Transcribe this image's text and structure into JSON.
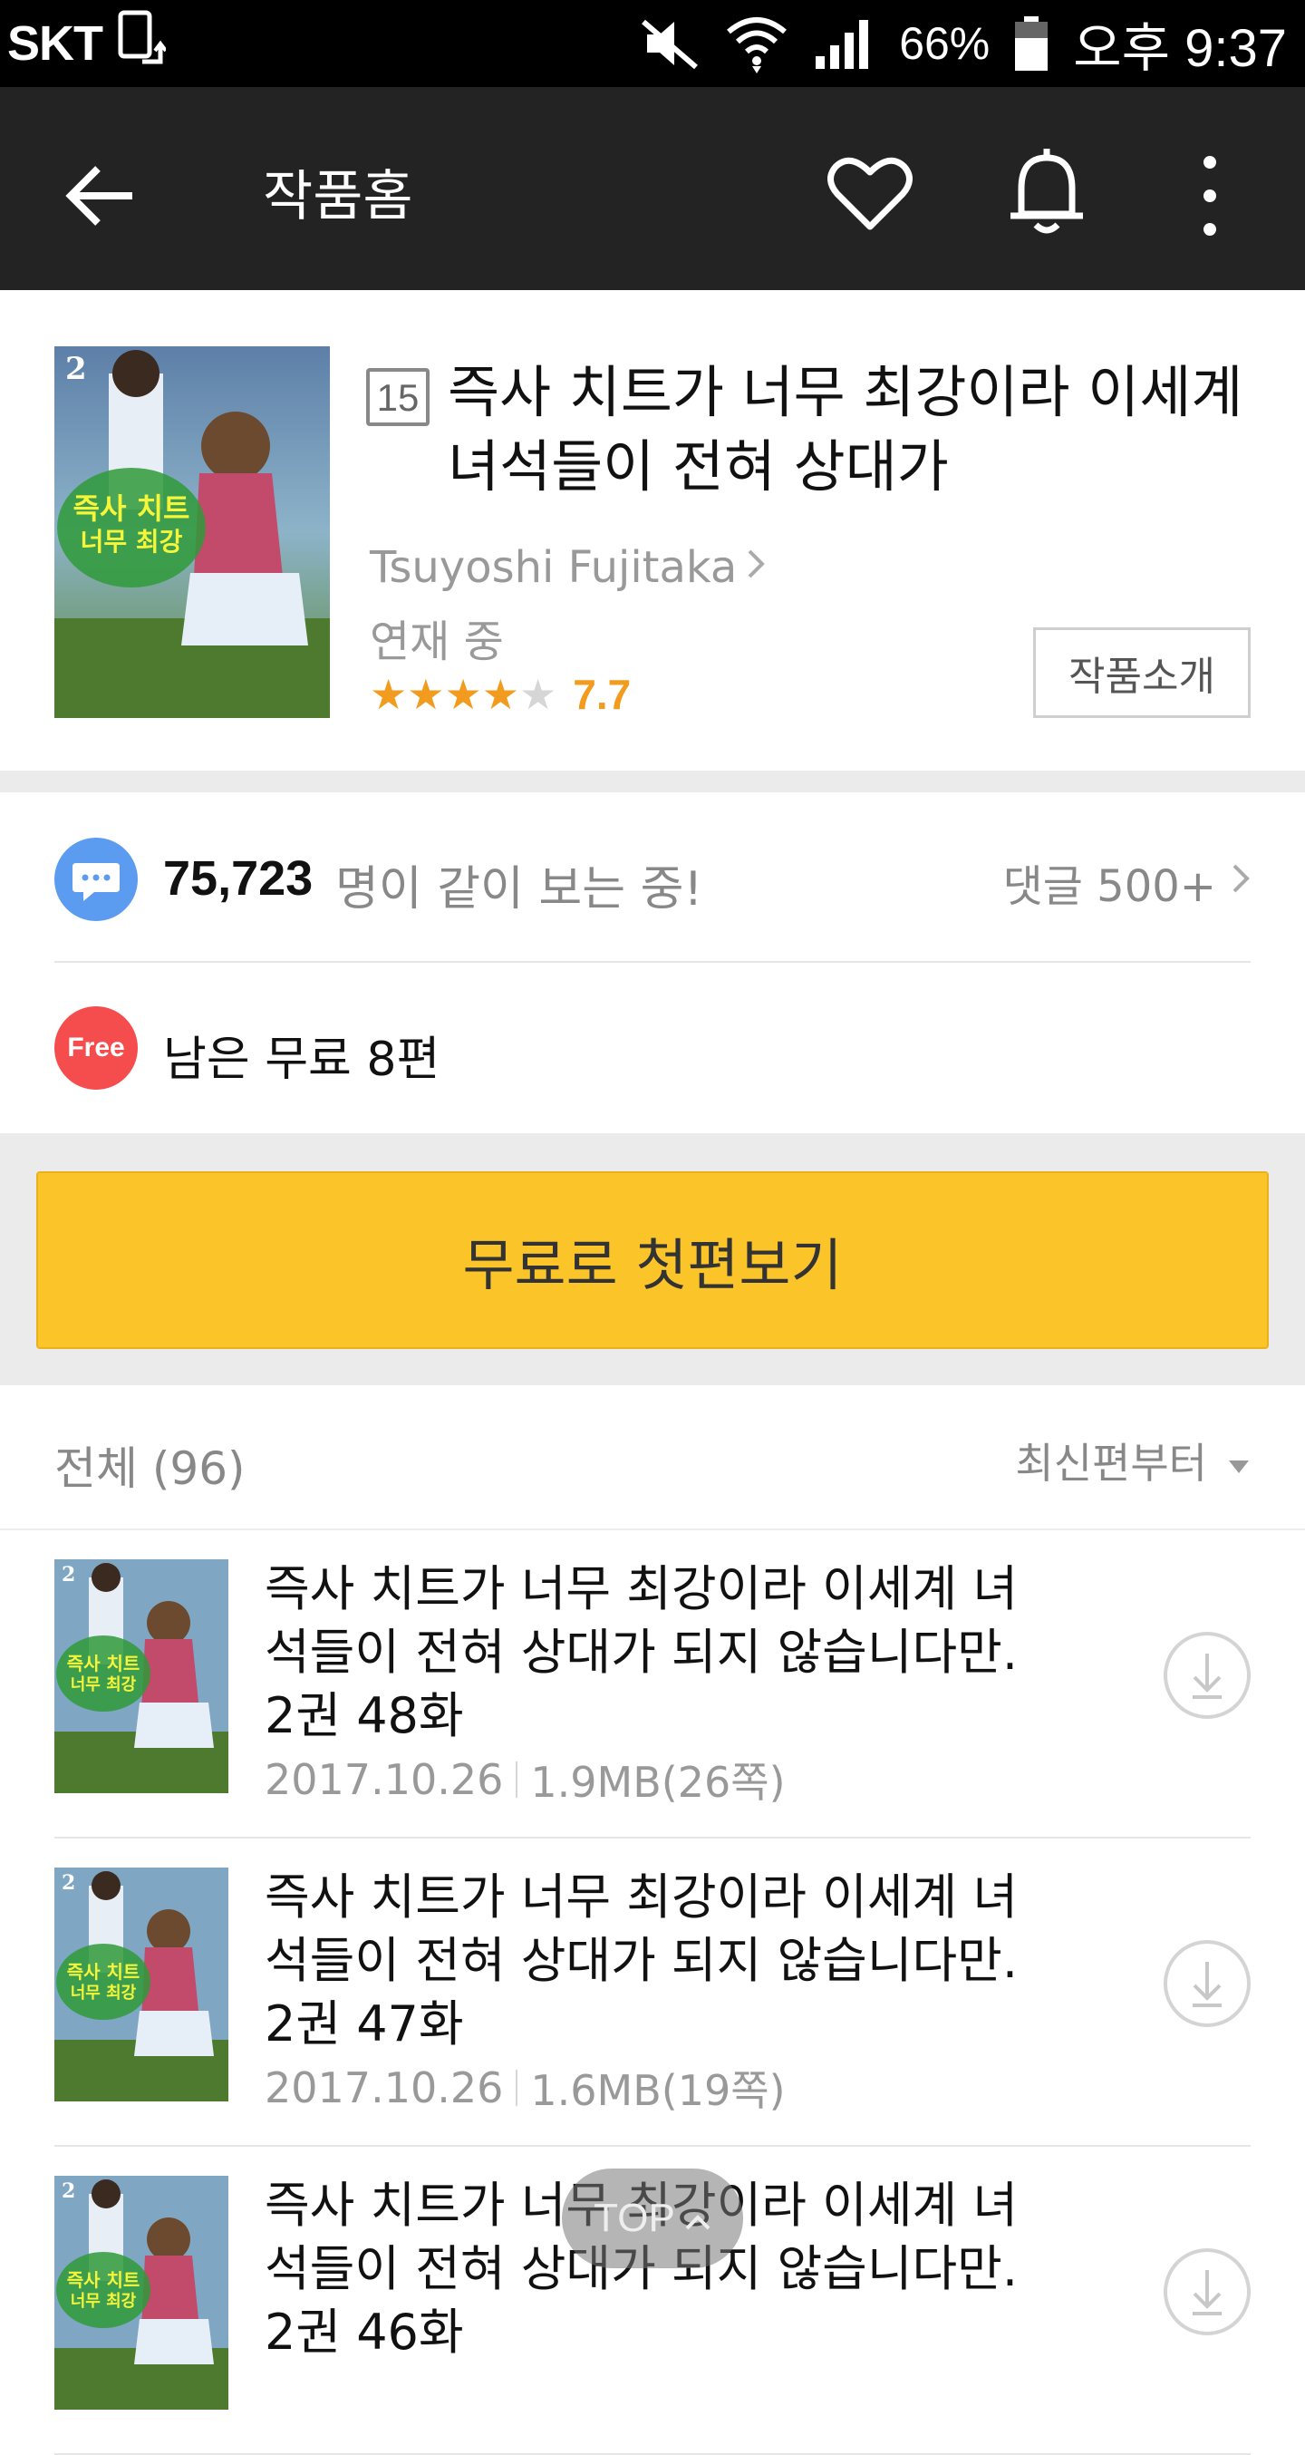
{
  "status_bar": {
    "carrier": "SKT",
    "battery_percent": "66%",
    "time": "오후 9:37"
  },
  "app_bar": {
    "title": "작품홈",
    "icons": [
      "back-arrow-icon",
      "heart-icon",
      "bell-icon",
      "more-vertical-icon"
    ]
  },
  "book": {
    "age_rating": "15",
    "title": "즉사 치트가 너무 최강이라 이세계 녀석들이 전혀 상대가",
    "author": "Tsuyoshi Fujitaka",
    "status": "연재 중",
    "rating_stars": 4,
    "rating_max": 5,
    "rating_value": "7.7",
    "intro_button": "작품소개"
  },
  "readers": {
    "count": "75,723",
    "text": "명이 같이 보는 중!",
    "comments": "댓글 500+"
  },
  "free": {
    "badge": "Free",
    "text": "남은 무료 8편"
  },
  "cta": {
    "label": "무료로 첫편보기"
  },
  "list": {
    "total_label": "전체 (96)",
    "sort_label": "최신편부터",
    "episodes": [
      {
        "title": "즉사 치트가 너무 최강이라 이세계 녀석들이 전혀 상대가 되지 않습니다만. 2권 48화",
        "date": "2017.10.26",
        "size": "1.9MB(26쪽)"
      },
      {
        "title": "즉사 치트가 너무 최강이라 이세계 녀석들이 전혀 상대가 되지 않습니다만. 2권 47화",
        "date": "2017.10.26",
        "size": "1.6MB(19쪽)"
      },
      {
        "title": "즉사 치트가 너무 최강이라 이세계 녀석들이 전혀 상대가 되지 않습니다만. 2권 46화",
        "date": "",
        "size": ""
      }
    ]
  },
  "top_button": {
    "label": "TOP"
  },
  "colors": {
    "app_bar_bg": "#232323",
    "cta_yellow": "#fbc52a",
    "star_orange": "#f29c1f",
    "free_red": "#f54d4d",
    "chat_blue": "#5b9cf0"
  }
}
